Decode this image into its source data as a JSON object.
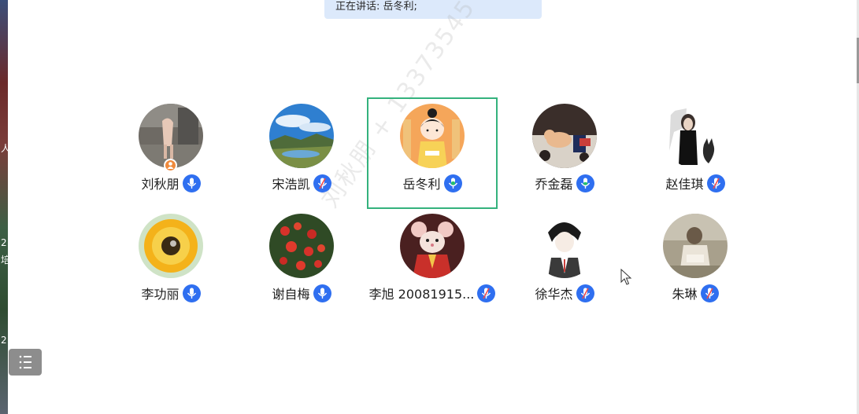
{
  "banner": {
    "speaking_label": "正在讲话: 岳冬利;"
  },
  "left_strip": {
    "chars": [
      "人",
      "2",
      "培",
      "2"
    ]
  },
  "watermark": {
    "text": "刘秋朋 + 13373545"
  },
  "participants": [
    {
      "name": "刘秋朋",
      "mic": "on",
      "host": true,
      "active": false,
      "avatar": "photo-person-courtyard"
    },
    {
      "name": "宋浩凯",
      "mic": "muted",
      "host": false,
      "active": false,
      "avatar": "photo-landscape-lake"
    },
    {
      "name": "岳冬利",
      "mic": "speaking",
      "host": false,
      "active": true,
      "avatar": "cartoon-girl-calligraphy"
    },
    {
      "name": "乔金磊",
      "mic": "on",
      "host": false,
      "active": false,
      "avatar": "photo-cat-desk"
    },
    {
      "name": "赵佳琪",
      "mic": "muted",
      "host": false,
      "active": false,
      "avatar": "illustration-girl-cat"
    },
    {
      "name": "李功丽",
      "mic": "on",
      "host": false,
      "active": false,
      "avatar": "photo-sunflower"
    },
    {
      "name": "谢自梅",
      "mic": "on",
      "host": false,
      "active": false,
      "avatar": "photo-red-berries"
    },
    {
      "name": "李旭 20081915...",
      "mic": "muted",
      "host": false,
      "active": false,
      "avatar": "illustration-mouse-red"
    },
    {
      "name": "徐华杰",
      "mic": "muted",
      "host": false,
      "active": false,
      "avatar": "illustration-anime-boy"
    },
    {
      "name": "朱琳",
      "mic": "muted",
      "host": false,
      "active": false,
      "avatar": "photo-person-reading"
    }
  ],
  "colors": {
    "active_border": "#34b27d",
    "mic_bg": "#2f6ff0",
    "speaking": "#27c26b",
    "host_badge": "#f08a3c"
  }
}
